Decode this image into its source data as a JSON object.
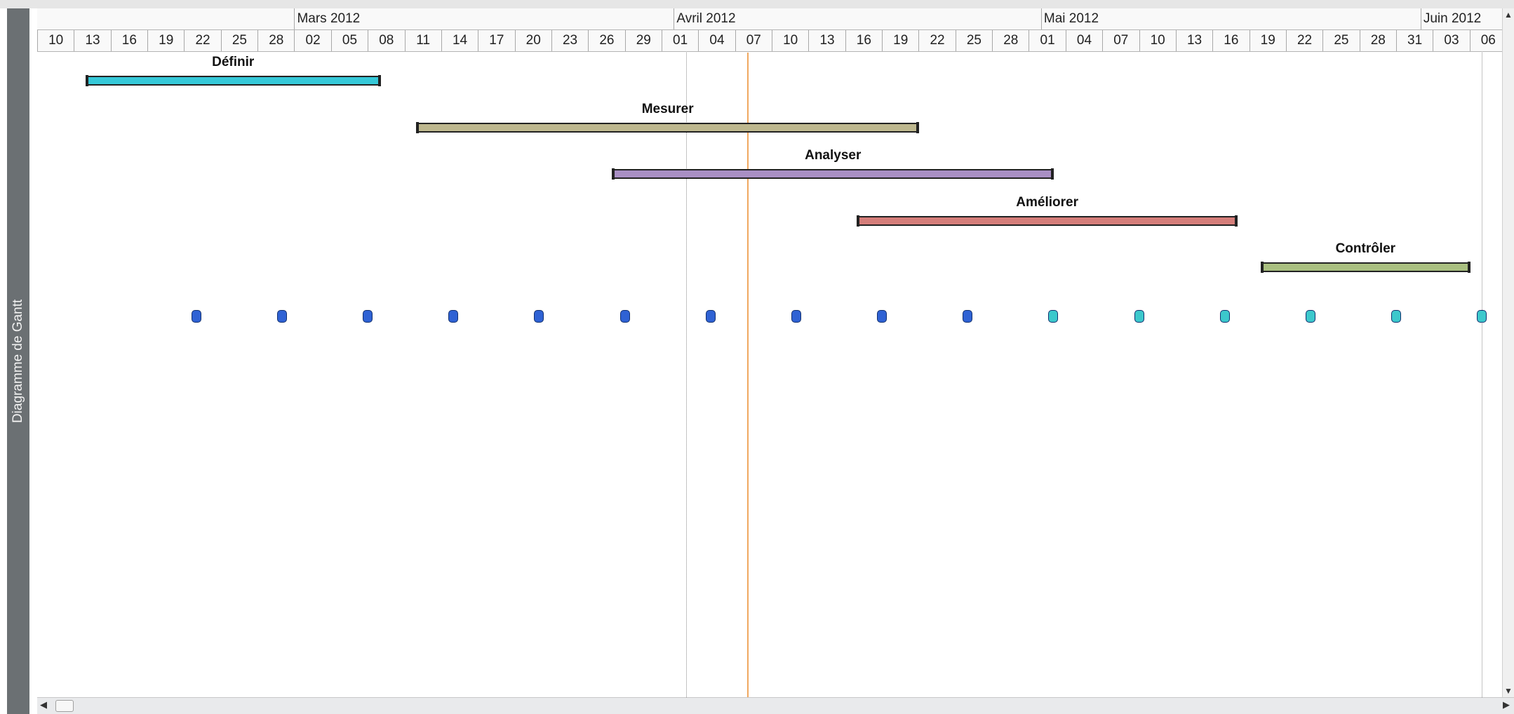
{
  "side_label": "Diagramme de Gantt",
  "timescale": {
    "months": [
      "Mars 2012",
      "Avril 2012",
      "Mai 2012",
      "Juin 2012"
    ],
    "days": [
      "10",
      "13",
      "16",
      "19",
      "22",
      "25",
      "28",
      "02",
      "05",
      "08",
      "11",
      "14",
      "17",
      "20",
      "23",
      "26",
      "29",
      "01",
      "04",
      "07",
      "10",
      "13",
      "16",
      "19",
      "22",
      "25",
      "28",
      "01",
      "04",
      "07",
      "10",
      "13",
      "16",
      "19",
      "22",
      "25",
      "28",
      "31",
      "03",
      "06"
    ]
  },
  "tasks": [
    {
      "name": "Définir",
      "start": "2012-02-13",
      "end": "2012-03-08",
      "color": "#35c8d8"
    },
    {
      "name": "Mesurer",
      "start": "2012-03-11",
      "end": "2012-04-21",
      "color": "#bdb78e"
    },
    {
      "name": "Analyser",
      "start": "2012-03-27",
      "end": "2012-05-02",
      "color": "#a98fc4"
    },
    {
      "name": "Améliorer",
      "start": "2012-04-16",
      "end": "2012-05-17",
      "color": "#d57e7a"
    },
    {
      "name": "Contrôler",
      "start": "2012-05-19",
      "end": "2012-06-05",
      "color": "#a9bf80"
    }
  ],
  "milestones": [
    {
      "date": "2012-02-22",
      "color": "#2f62d4"
    },
    {
      "date": "2012-02-29",
      "color": "#2f62d4"
    },
    {
      "date": "2012-03-07",
      "color": "#2f62d4"
    },
    {
      "date": "2012-03-14",
      "color": "#2f62d4"
    },
    {
      "date": "2012-03-21",
      "color": "#2f62d4"
    },
    {
      "date": "2012-03-28",
      "color": "#2f62d4"
    },
    {
      "date": "2012-04-04",
      "color": "#2f62d4"
    },
    {
      "date": "2012-04-11",
      "color": "#2f62d4"
    },
    {
      "date": "2012-04-18",
      "color": "#2f62d4"
    },
    {
      "date": "2012-04-25",
      "color": "#2f62d4"
    },
    {
      "date": "2012-05-02",
      "color": "#3cc8cc"
    },
    {
      "date": "2012-05-09",
      "color": "#3cc8cc"
    },
    {
      "date": "2012-05-16",
      "color": "#3cc8cc"
    },
    {
      "date": "2012-05-23",
      "color": "#3cc8cc"
    },
    {
      "date": "2012-05-30",
      "color": "#3cc8cc"
    },
    {
      "date": "2012-06-06",
      "color": "#3cc8cc"
    }
  ],
  "markers": {
    "today_date": "2012-04-07",
    "dotted_dates": [
      "2012-04-02",
      "2012-06-06"
    ],
    "today_color": "#f0a860"
  }
}
